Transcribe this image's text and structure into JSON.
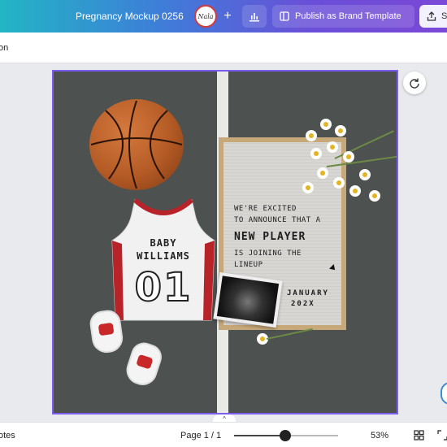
{
  "header": {
    "doc_title": "Pregnancy Mockup 0256",
    "avatar_text": "Nala",
    "add_symbol": "+",
    "publish_label": "Publish as Brand Template",
    "share_label": "S"
  },
  "toolbar": {
    "left_label": "on"
  },
  "design": {
    "jersey_line1": "BABY",
    "jersey_line2": "WILLIAMS",
    "jersey_number": "01",
    "board_line1": "WE'RE EXCITED",
    "board_line2": "TO ANNOUNCE THAT A",
    "board_line3": "NEW PLAYER",
    "board_line4": "IS JOINING THE",
    "board_line5": "LINEUP",
    "board_month": "JANUARY",
    "board_year": "202X"
  },
  "footer": {
    "notes_label": "otes",
    "page_info": "Page 1 / 1",
    "zoom_label": "53%",
    "zoom_fraction": 0.49,
    "collapse_symbol": "^"
  },
  "colors": {
    "selection": "#7d5cf0",
    "header_start": "#22b5c4",
    "header_end": "#7a48d6"
  }
}
